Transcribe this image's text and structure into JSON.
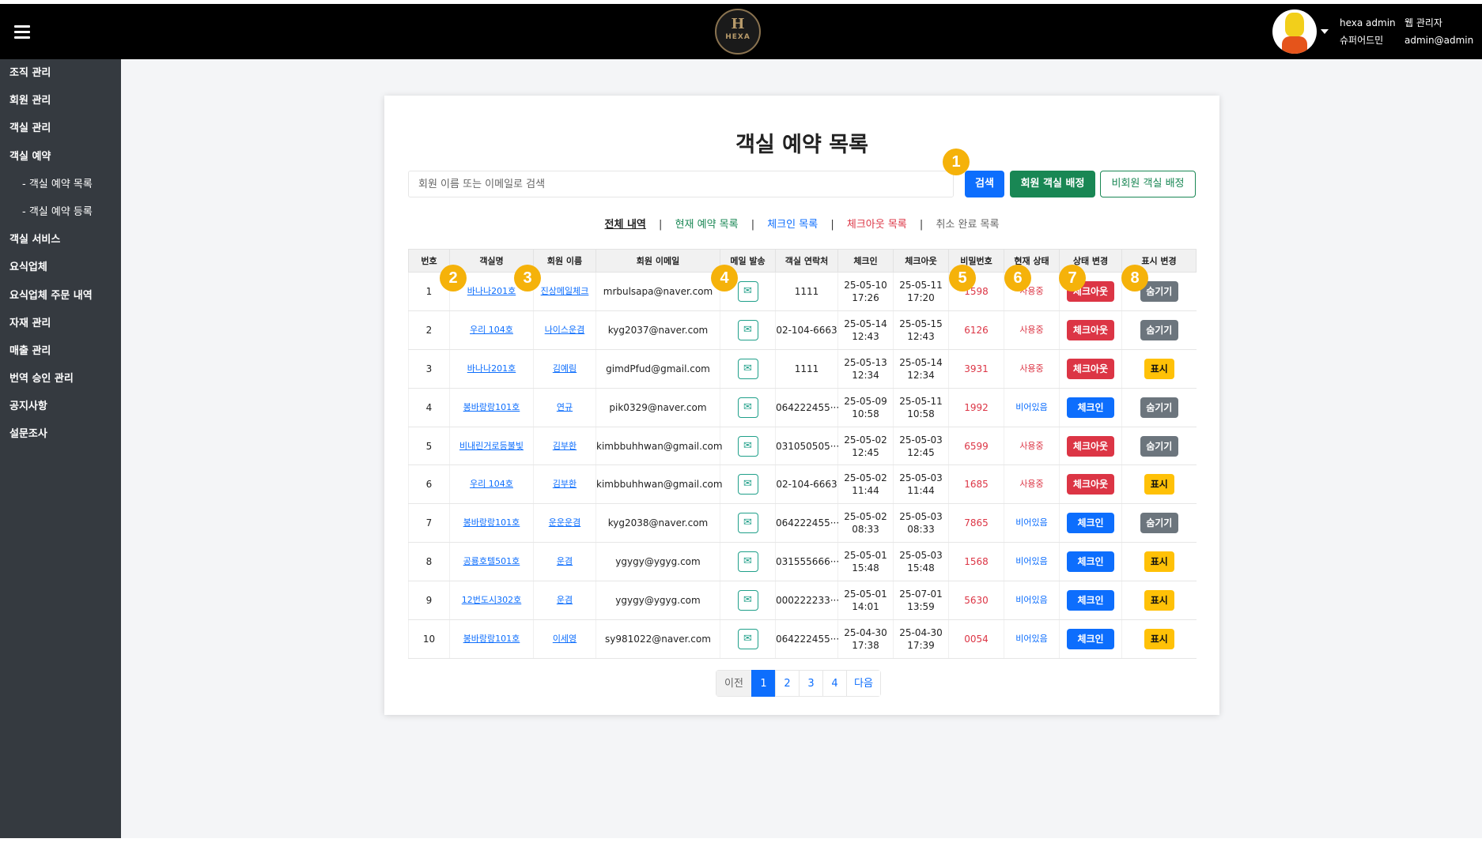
{
  "header": {
    "logo_letter": "H",
    "logo_text": "HEXA",
    "user": {
      "name": "hexa admin",
      "role": "웹 관리자",
      "grade": "슈퍼어드민",
      "email": "admin@admin"
    }
  },
  "sidebar": {
    "items": [
      {
        "label": "조직 관리",
        "sub": false
      },
      {
        "label": "회원 관리",
        "sub": false
      },
      {
        "label": "객실 관리",
        "sub": false
      },
      {
        "label": "객실 예약",
        "sub": false
      },
      {
        "label": "- 객실 예약 목록",
        "sub": true
      },
      {
        "label": "- 객실 예약 등록",
        "sub": true
      },
      {
        "label": "객실 서비스",
        "sub": false
      },
      {
        "label": "요식업체",
        "sub": false
      },
      {
        "label": "요식업체 주문 내역",
        "sub": false
      },
      {
        "label": "자재 관리",
        "sub": false
      },
      {
        "label": "매출 관리",
        "sub": false
      },
      {
        "label": "번역 승인 관리",
        "sub": false
      },
      {
        "label": "공지사항",
        "sub": false
      },
      {
        "label": "설문조사",
        "sub": false
      }
    ]
  },
  "main": {
    "title": "객실 예약 목록",
    "search": {
      "placeholder": "회원 이름 또는 이메일로 검색",
      "search_label": "검색",
      "member_assign_label": "회원 객실 배정",
      "guest_assign_label": "비회원 객실 배정"
    },
    "filters": {
      "all": "전체 내역",
      "current": "현재 예약 목록",
      "checkin": "체크인 목록",
      "checkout": "체크아웃 목록",
      "cancelled": "취소 완료 목록",
      "separator": "|"
    },
    "table": {
      "columns": [
        "번호",
        "객실명",
        "회원 이름",
        "회원 이메일",
        "메일 발송",
        "객실 연락처",
        "체크인",
        "체크아웃",
        "비밀번호",
        "현재 상태",
        "상태 변경",
        "표시 변경"
      ],
      "mail_icon": "✉",
      "rows": [
        {
          "no": "1",
          "room": "바나나201호",
          "name": "진상메일체크",
          "email": "mrbulsapa@naver.com",
          "phone": "1111",
          "checkin_date": "25-05-10",
          "checkin_time": "17:26",
          "checkout_date": "25-05-11",
          "checkout_time": "17:20",
          "password": "1598",
          "status": "사용중",
          "status_type": "using",
          "action": "체크아웃",
          "action_type": "out",
          "display": "숨기기",
          "display_type": "hide"
        },
        {
          "no": "2",
          "room": "우리 104호",
          "name": "나이스운겸",
          "email": "kyg2037@naver.com",
          "phone": "02-104-6663",
          "checkin_date": "25-05-14",
          "checkin_time": "12:43",
          "checkout_date": "25-05-15",
          "checkout_time": "12:43",
          "password": "6126",
          "status": "사용중",
          "status_type": "using",
          "action": "체크아웃",
          "action_type": "out",
          "display": "숨기기",
          "display_type": "hide"
        },
        {
          "no": "3",
          "room": "바나나201호",
          "name": "김예림",
          "email": "gimdPfud@gmail.com",
          "phone": "1111",
          "checkin_date": "25-05-13",
          "checkin_time": "12:34",
          "checkout_date": "25-05-14",
          "checkout_time": "12:34",
          "password": "3931",
          "status": "사용중",
          "status_type": "using",
          "action": "체크아웃",
          "action_type": "out",
          "display": "표시",
          "display_type": "show"
        },
        {
          "no": "4",
          "room": "봉바랑랑101호",
          "name": "연규",
          "email": "pik0329@naver.com",
          "phone": "064222455···",
          "checkin_date": "25-05-09",
          "checkin_time": "10:58",
          "checkout_date": "25-05-11",
          "checkout_time": "10:58",
          "password": "1992",
          "status": "비어있음",
          "status_type": "empty",
          "action": "체크인",
          "action_type": "in",
          "display": "숨기기",
          "display_type": "hide"
        },
        {
          "no": "5",
          "room": "비내린거로등불빛",
          "name": "김부환",
          "email": "kimbbuhhwan@gmail.com",
          "phone": "031050505···",
          "checkin_date": "25-05-02",
          "checkin_time": "12:45",
          "checkout_date": "25-05-03",
          "checkout_time": "12:45",
          "password": "6599",
          "status": "사용중",
          "status_type": "using",
          "action": "체크아웃",
          "action_type": "out",
          "display": "숨기기",
          "display_type": "hide"
        },
        {
          "no": "6",
          "room": "우리 104호",
          "name": "김부환",
          "email": "kimbbuhhwan@gmail.com",
          "phone": "02-104-6663",
          "checkin_date": "25-05-02",
          "checkin_time": "11:44",
          "checkout_date": "25-05-03",
          "checkout_time": "11:44",
          "password": "1685",
          "status": "사용중",
          "status_type": "using",
          "action": "체크아웃",
          "action_type": "out",
          "display": "표시",
          "display_type": "show"
        },
        {
          "no": "7",
          "room": "봉바랑랑101호",
          "name": "운운운겸",
          "email": "kyg2038@naver.com",
          "phone": "064222455···",
          "checkin_date": "25-05-02",
          "checkin_time": "08:33",
          "checkout_date": "25-05-03",
          "checkout_time": "08:33",
          "password": "7865",
          "status": "비어있음",
          "status_type": "empty",
          "action": "체크인",
          "action_type": "in",
          "display": "숨기기",
          "display_type": "hide"
        },
        {
          "no": "8",
          "room": "공룡호텔501호",
          "name": "운겸",
          "email": "ygygy@ygyg.com",
          "phone": "031555666···",
          "checkin_date": "25-05-01",
          "checkin_time": "15:48",
          "checkout_date": "25-05-03",
          "checkout_time": "15:48",
          "password": "1568",
          "status": "비어있음",
          "status_type": "empty",
          "action": "체크인",
          "action_type": "in",
          "display": "표시",
          "display_type": "show"
        },
        {
          "no": "9",
          "room": "12번도시302호",
          "name": "운겸",
          "email": "ygygy@ygyg.com",
          "phone": "000222233···",
          "checkin_date": "25-05-01",
          "checkin_time": "14:01",
          "checkout_date": "25-07-01",
          "checkout_time": "13:59",
          "password": "5630",
          "status": "비어있음",
          "status_type": "empty",
          "action": "체크인",
          "action_type": "in",
          "display": "표시",
          "display_type": "show"
        },
        {
          "no": "10",
          "room": "봉바랑랑101호",
          "name": "이세영",
          "email": "sy981022@naver.com",
          "phone": "064222455···",
          "checkin_date": "25-04-30",
          "checkin_time": "17:38",
          "checkout_date": "25-04-30",
          "checkout_time": "17:39",
          "password": "0054",
          "status": "비어있음",
          "status_type": "empty",
          "action": "체크인",
          "action_type": "in",
          "display": "표시",
          "display_type": "show"
        }
      ]
    },
    "pagination": {
      "prev": "이전",
      "pages": [
        "1",
        "2",
        "3",
        "4"
      ],
      "active": "1",
      "next": "다음"
    }
  },
  "annotations": [
    "1",
    "2",
    "3",
    "4",
    "5",
    "6",
    "7",
    "8"
  ],
  "colors": {
    "primary": "#0d6efd",
    "success": "#198754",
    "danger": "#dc3545",
    "warning": "#ffc107",
    "secondary": "#6c757d",
    "sidebar": "#353a40",
    "badge": "#f5b20a"
  }
}
